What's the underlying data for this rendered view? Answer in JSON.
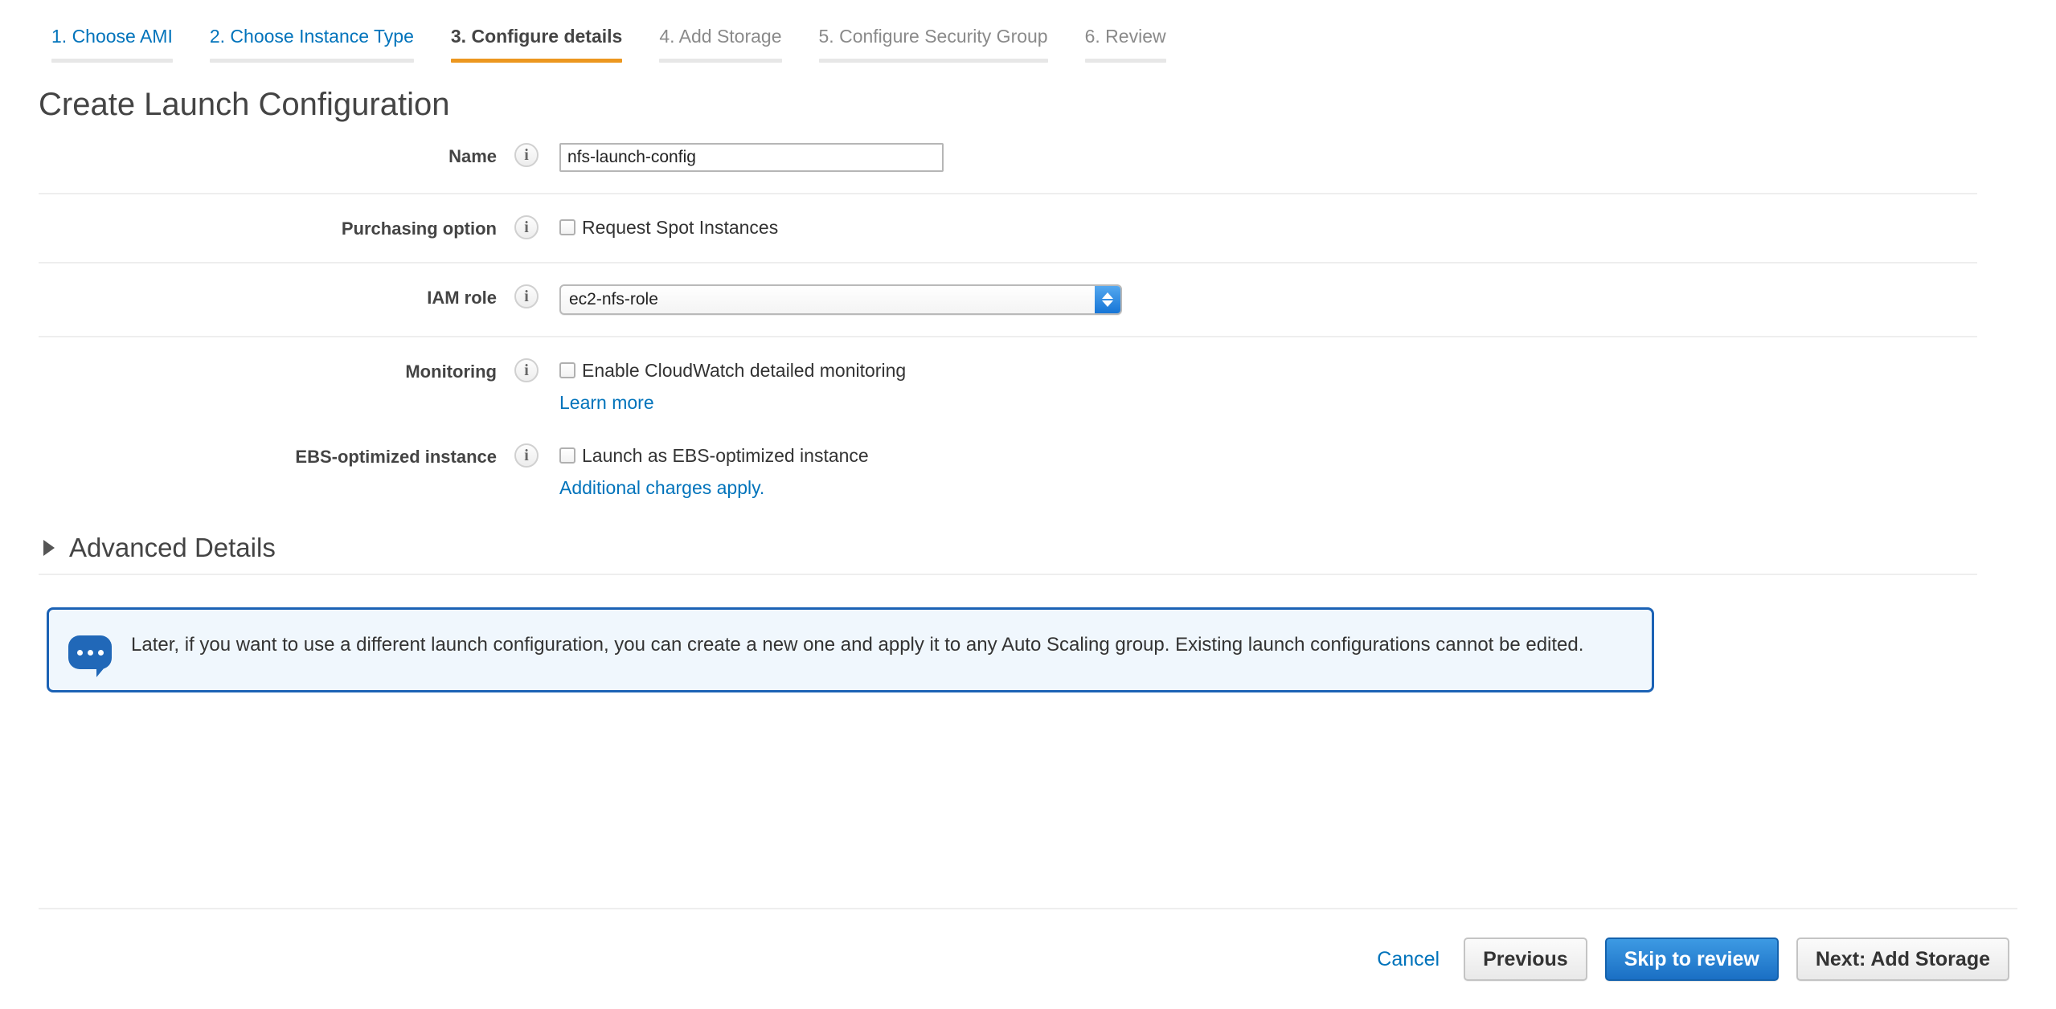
{
  "wizard": {
    "tabs": [
      {
        "label": "1. Choose AMI",
        "state": "link"
      },
      {
        "label": "2. Choose Instance Type",
        "state": "link"
      },
      {
        "label": "3. Configure details",
        "state": "active"
      },
      {
        "label": "4. Add Storage",
        "state": "muted"
      },
      {
        "label": "5. Configure Security Group",
        "state": "muted"
      },
      {
        "label": "6. Review",
        "state": "muted"
      }
    ],
    "active_underline_color": "#ec971f",
    "link_color": "#0073bb"
  },
  "page_title": "Create Launch Configuration",
  "form": {
    "info_icon_glyph": "i",
    "name": {
      "label": "Name",
      "value": "nfs-launch-config",
      "placeholder": ""
    },
    "purchasing_option": {
      "label": "Purchasing option",
      "checkbox_label": "Request Spot Instances",
      "checked": false
    },
    "iam_role": {
      "label": "IAM role",
      "selected": "ec2-nfs-role"
    },
    "monitoring": {
      "label": "Monitoring",
      "checkbox_label": "Enable CloudWatch detailed monitoring",
      "checked": false,
      "link": "Learn more"
    },
    "ebs_optimized": {
      "label": "EBS-optimized instance",
      "checkbox_label": "Launch as EBS-optimized instance",
      "checked": false,
      "link": "Additional charges apply."
    }
  },
  "advanced_details": {
    "title": "Advanced Details",
    "expanded": false
  },
  "callout": {
    "icon": "speech-bubble-icon",
    "text": "Later, if you want to use a different launch configuration, you can create a new one and apply it to any Auto Scaling group. Existing launch configurations cannot be edited.",
    "border_color": "#1b62b5",
    "background_color": "#f0f7fd"
  },
  "footer": {
    "cancel": "Cancel",
    "previous": "Previous",
    "skip_to_review": "Skip to review",
    "next": "Next: Add Storage",
    "primary_color": "#1a6fc4"
  }
}
